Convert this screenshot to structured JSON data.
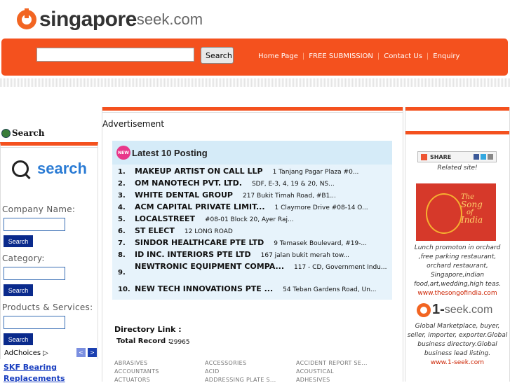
{
  "logo": {
    "brand": "singapore",
    "seek": "seek.com"
  },
  "header": {
    "search_button": "Search",
    "nav": [
      "Home Page",
      "FREE SUBMISSION",
      "Contact Us",
      "Enquiry"
    ]
  },
  "left": {
    "title": "Search",
    "logo_text": "search",
    "fields": [
      {
        "label": "Company Name:",
        "button": "Search"
      },
      {
        "label": "Category:",
        "button": "Search"
      },
      {
        "label": "Products & Services:",
        "button": "Search"
      }
    ],
    "adchoices": "AdChoices",
    "ad_links": [
      "SKF Bearing",
      "Replacements"
    ]
  },
  "main": {
    "advertisement": "Advertisement",
    "new_badge": "NEW",
    "latest_title": "Latest 10 Posting",
    "postings": [
      {
        "num": "1.",
        "name": "MAKEUP ARTIST ON CALL LLP",
        "addr": "1 Tanjang Pagar Plaza #0..."
      },
      {
        "num": "2.",
        "name": "OM NANOTECH PVT. LTD.",
        "addr": "SDF, E-3, 4, 19 & 20, NS..."
      },
      {
        "num": "3.",
        "name": "WHITE DENTAL GROUP",
        "addr": "217 Bukit Timah Road, #B1..."
      },
      {
        "num": "4.",
        "name": "ACM CAPITAL PRIVATE LIMIT...",
        "addr": "1 Claymore Drive #08-14 O..."
      },
      {
        "num": "5.",
        "name": "LOCALSTREET",
        "addr": "#08-01 Block 20, Ayer Raj..."
      },
      {
        "num": "6.",
        "name": "ST ELECT",
        "addr": "12 LONG ROAD"
      },
      {
        "num": "7.",
        "name": "SINDOR HEALTHCARE PTE LTD",
        "addr": "9 Temasek Boulevard, #19-..."
      },
      {
        "num": "8.",
        "name": "ID INC. INTERIORS PTE LTD",
        "addr": "167 jalan bukit merah tow..."
      },
      {
        "num": "9.",
        "name": "NEWTRONIC EQUIPMENT COMPA...",
        "addr": "117 - CD, Government Indu..."
      },
      {
        "num": "10.",
        "name": "NEW TECH INNOVATIONS PTE ...",
        "addr": "54 Teban Gardens Road, Un..."
      }
    ],
    "directory_link": "Directory Link :",
    "total_record_label": "Total Record :",
    "total_record_value": "29965",
    "categories": [
      [
        "ABRASIVES",
        "ACCESSORIES",
        "ACCIDENT REPORT SE..."
      ],
      [
        "ACCOUNTANTS",
        "ACID",
        "ACOUSTICAL"
      ],
      [
        "ACTUATORS",
        "ADDRESSING PLATE S...",
        "ADHESIVES"
      ]
    ]
  },
  "right": {
    "share": "SHARE",
    "related": "Related site!",
    "song_img_lines": [
      "The",
      "Song",
      "of",
      "India"
    ],
    "song_desc": "Lunch promoton in orchard ,free parking restaurant, orchard restaurant, Singapore,indian food,art,wedding,high teas.",
    "song_link": "www.thesongofindia.com",
    "oneseek_a": "1-",
    "oneseek_b": "seek.com",
    "oneseek_desc": "Global Marketplace, buyer, seller, importer, exporter.Global business directory.Global business lead listing.",
    "oneseek_link": "www.1-seek.com"
  }
}
